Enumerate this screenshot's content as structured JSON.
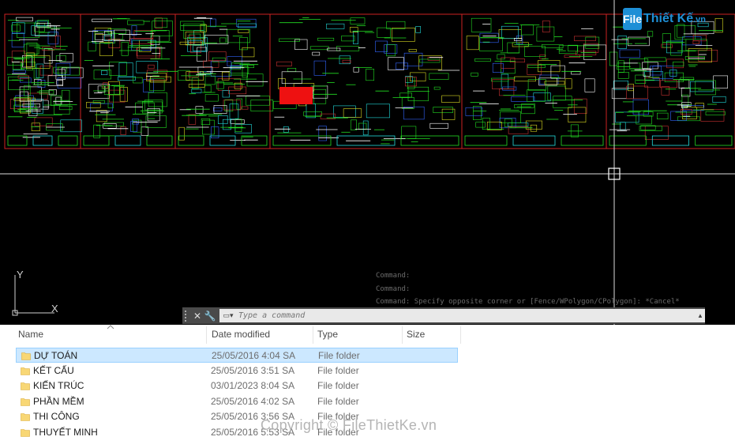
{
  "cad": {
    "command_history": [
      "Command:",
      "Command:",
      "Command: Specify opposite corner or [Fence/WPolygon/CPolygon]: *Cancel*"
    ],
    "command_placeholder": "Type a command",
    "axis_y": "Y",
    "axis_x": "X",
    "colors": {
      "background": "#000000",
      "drawing_green": "#22dd22",
      "border_red": "#cc2222"
    }
  },
  "watermark": {
    "logo_mark": "File",
    "logo_text_1": "Thiết Kế",
    "logo_text_2": ".vn",
    "copyright": "Copyright © FileThietKe.vn"
  },
  "explorer": {
    "columns": {
      "name": "Name",
      "date": "Date modified",
      "type": "Type",
      "size": "Size"
    },
    "rows": [
      {
        "name": "DỰ TOÁN",
        "date": "25/05/2016 4:04 SA",
        "type": "File folder",
        "size": "",
        "selected": true
      },
      {
        "name": "KẾT CẤU",
        "date": "25/05/2016 3:51 SA",
        "type": "File folder",
        "size": ""
      },
      {
        "name": "KIẾN TRÚC",
        "date": "03/01/2023 8:04 SA",
        "type": "File folder",
        "size": ""
      },
      {
        "name": "PHẦN MỀM",
        "date": "25/05/2016 4:02 SA",
        "type": "File folder",
        "size": ""
      },
      {
        "name": "THI CÔNG",
        "date": "25/05/2016 3:56 SA",
        "type": "File folder",
        "size": ""
      },
      {
        "name": "THUYẾT MINH",
        "date": "25/05/2016 5:53 SA",
        "type": "File folder",
        "size": ""
      }
    ]
  }
}
